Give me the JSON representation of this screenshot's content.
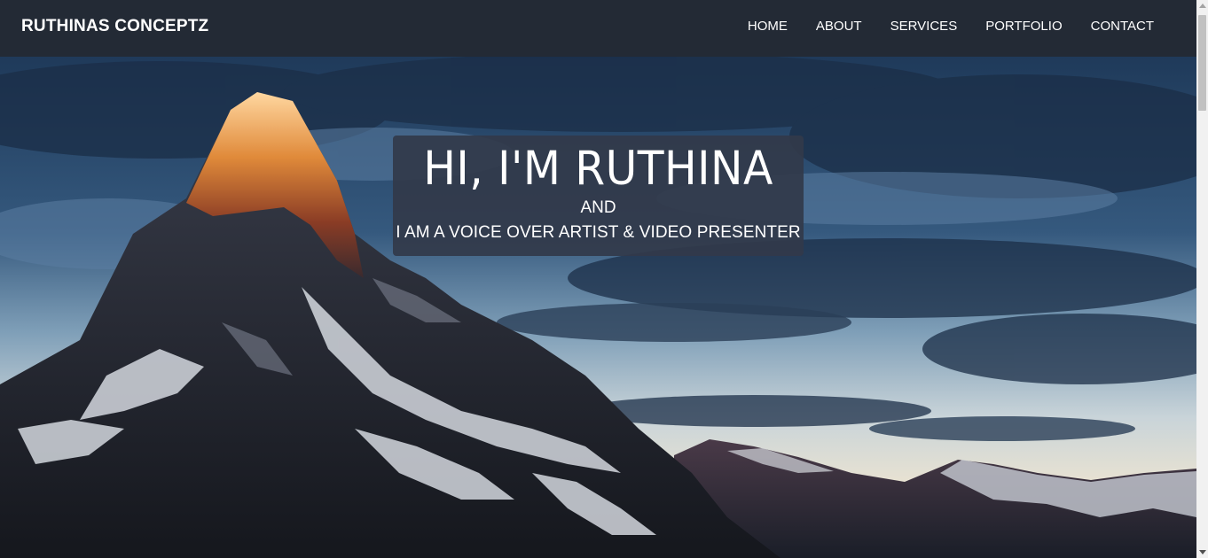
{
  "navbar": {
    "brand": "RUTHINAS CONCEPTZ",
    "links": [
      "HOME",
      "ABOUT",
      "SERVICES",
      "PORTFOLIO",
      "CONTACT"
    ]
  },
  "hero": {
    "title": "HI, I'M RUTHINA",
    "connector": "AND",
    "subtitle": "I AM A VOICE OVER ARTIST & VIDEO PRESENTER",
    "background": "mountain-landscape-image"
  },
  "colors": {
    "navbar_bg": "#232a35",
    "hero_box_bg": "#323a4a",
    "text": "#ffffff"
  }
}
